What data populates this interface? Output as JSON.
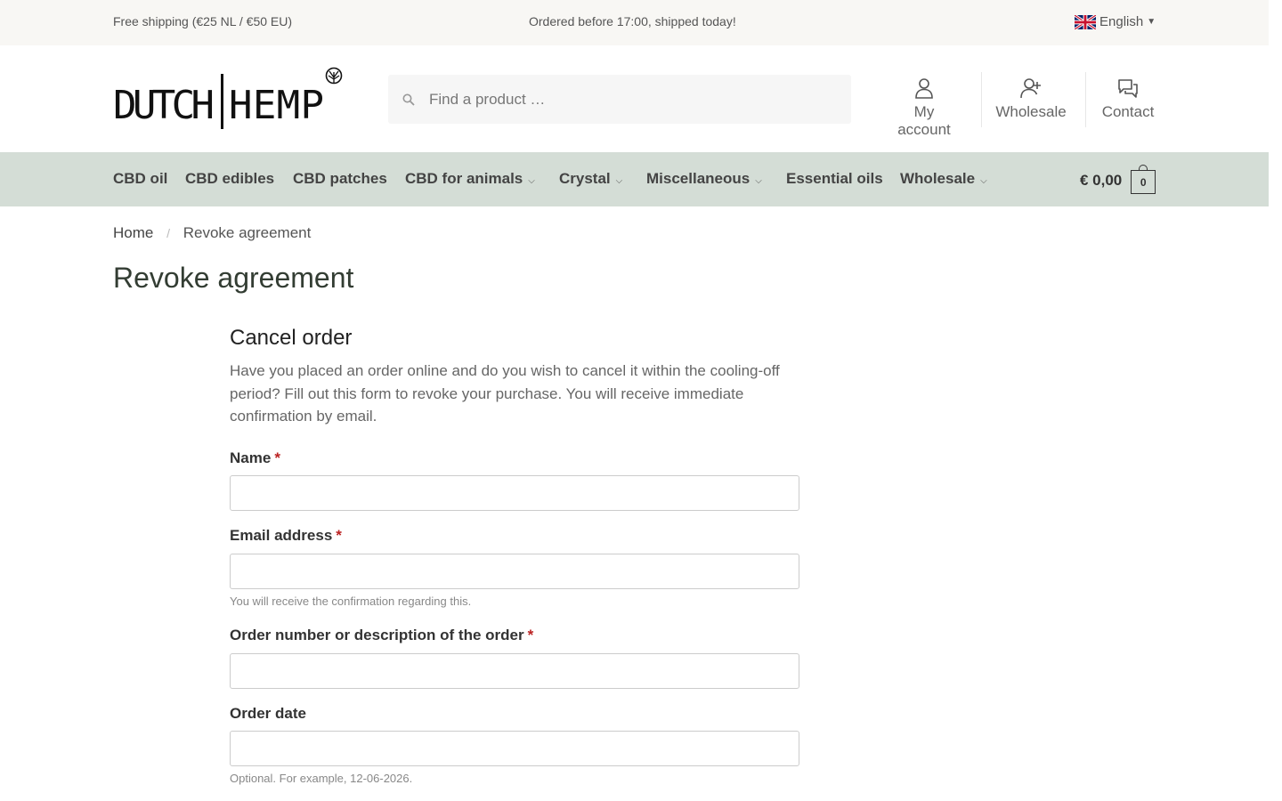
{
  "topbar": {
    "shipping": "Free shipping (€25 NL / €50 EU)",
    "dispatch": "Ordered before 17:00, shipped today!",
    "language": "English",
    "language_flag_icon": "uk-flag-icon"
  },
  "header": {
    "logo_text": "DUTCH|HEMP",
    "search": {
      "placeholder": "Find a product …",
      "value": ""
    },
    "links": [
      {
        "label": "My account",
        "icon": "user-icon"
      },
      {
        "label": "Wholesale",
        "icon": "user-plus-icon"
      },
      {
        "label": "Contact",
        "icon": "chat-icon"
      }
    ]
  },
  "nav": {
    "items": [
      {
        "label": "CBD oil",
        "has_dropdown": false
      },
      {
        "label": "CBD edibles",
        "has_dropdown": false
      },
      {
        "label": "CBD patches",
        "has_dropdown": false
      },
      {
        "label": "CBD for animals",
        "has_dropdown": true
      },
      {
        "label": "Crystal",
        "has_dropdown": true
      },
      {
        "label": "Miscellaneous",
        "has_dropdown": true
      },
      {
        "label": "Essential oils",
        "has_dropdown": false
      },
      {
        "label": "Wholesale",
        "has_dropdown": true
      }
    ],
    "cart_total": "€ 0,00",
    "cart_count": "0",
    "background": "#d4ddd6"
  },
  "breadcrumb": {
    "home": "Home",
    "current": "Revoke agreement"
  },
  "page_title": "Revoke agreement",
  "form": {
    "title": "Cancel order",
    "intro": "Have you placed an order online and do you wish to cancel it within the cooling-off period? Fill out this form to revoke your purchase. You will receive immediate confirmation by email.",
    "fields": [
      {
        "label": "Name",
        "required_mark": "*",
        "value": "",
        "help": ""
      },
      {
        "label": "Email address",
        "required_mark": "*",
        "value": "",
        "help": "You will receive the confirmation regarding this."
      },
      {
        "label": "Order number or description of the order",
        "required_mark": "*",
        "value": "",
        "help": ""
      },
      {
        "label": "Order date",
        "required_mark": "",
        "value": "",
        "help": "Optional. For example, 12-06-2026."
      }
    ],
    "required_color": "#b22222"
  }
}
